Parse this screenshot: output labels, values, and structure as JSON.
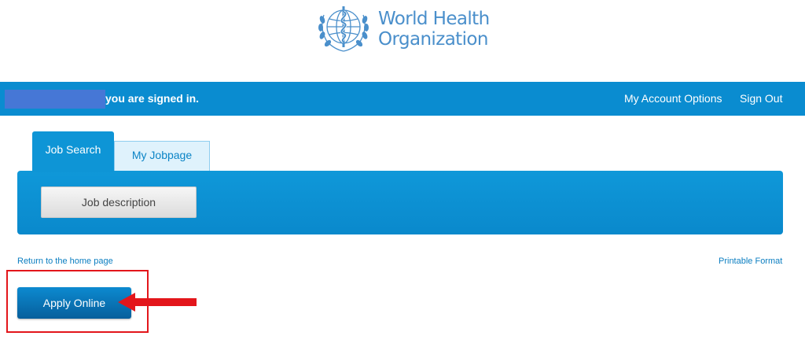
{
  "logo": {
    "line1": "World Health",
    "line2": "Organization"
  },
  "topbar": {
    "signed_in_text": "you are signed in.",
    "account_options": "My Account Options",
    "sign_out": "Sign Out"
  },
  "tabs": [
    {
      "label": "Job Search",
      "active": true
    },
    {
      "label": "My Jobpage",
      "active": false
    }
  ],
  "panel": {
    "job_description_button": "Job description"
  },
  "links": {
    "return_home": "Return to the home page",
    "printable": "Printable Format"
  },
  "apply": {
    "label": "Apply Online"
  },
  "colors": {
    "brand_blue": "#0a8cd0",
    "logo_blue": "#4a8fcb",
    "annotation_red": "#e3161b"
  },
  "icons": {
    "logo": "who-emblem-icon",
    "annotation": "arrow-left-icon"
  }
}
